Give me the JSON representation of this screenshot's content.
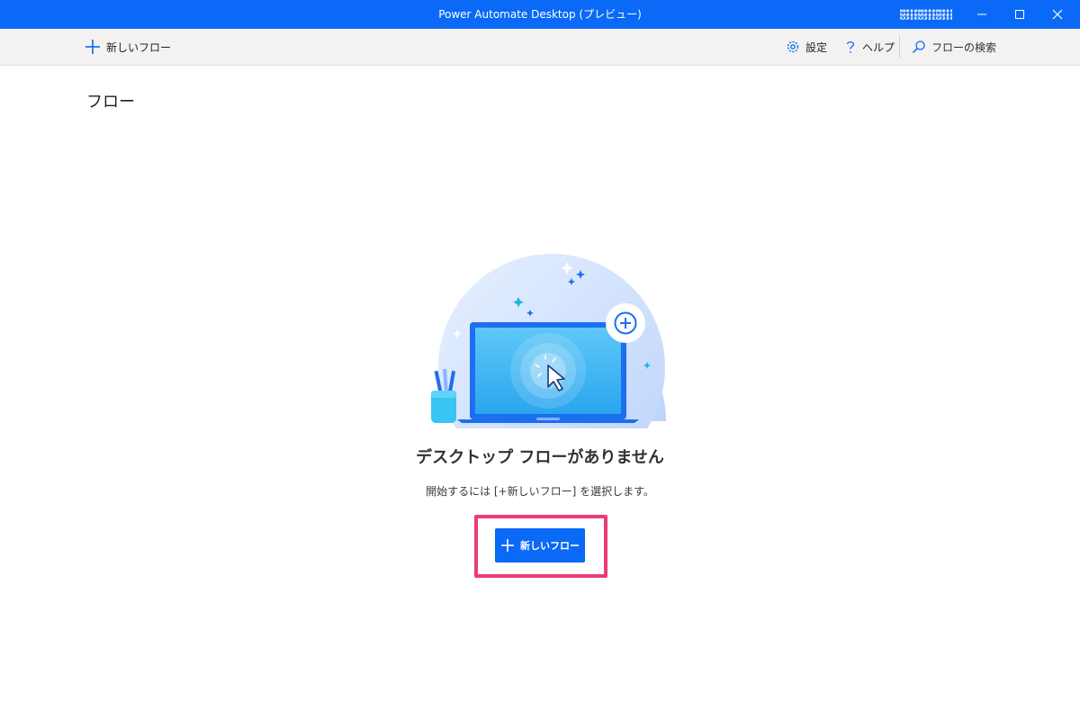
{
  "window": {
    "title": "Power Automate Desktop (プレビュー)"
  },
  "toolbar": {
    "new_flow_label": "新しいフロー",
    "settings_label": "設定",
    "help_label": "ヘルプ",
    "search_placeholder": "フローの検索"
  },
  "page": {
    "title": "フロー"
  },
  "empty_state": {
    "heading": "デスクトップ フローがありません",
    "subtext": "開始するには [+新しいフロー] を選択します。",
    "button_label": "新しいフロー"
  },
  "icons": {
    "plus": "plus-icon",
    "settings": "gear-icon",
    "help": "question-icon",
    "search": "search-icon",
    "minimize": "minimize-icon",
    "maximize": "maximize-icon",
    "close": "close-icon"
  },
  "colors": {
    "accent": "#0a69f7",
    "highlight": "#ec3b78",
    "toolbar_bg": "#f3f2f1"
  }
}
